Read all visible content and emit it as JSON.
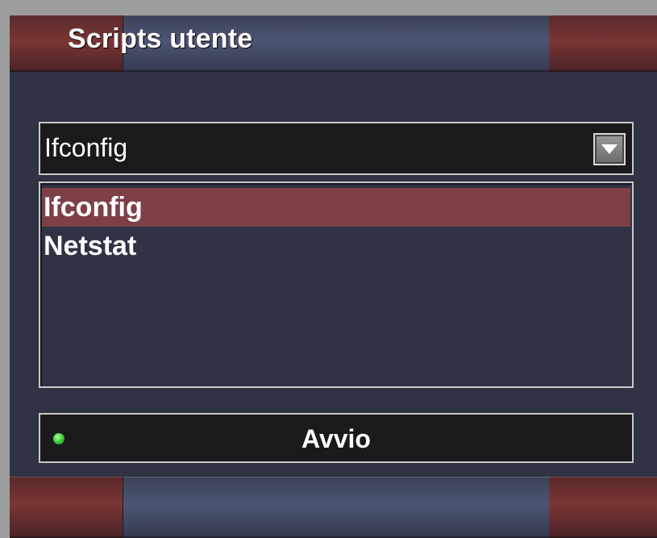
{
  "window": {
    "title": "Scripts utente"
  },
  "dropdown": {
    "selected_value": "Ifconfig",
    "icon": "chevron-down-icon"
  },
  "script_list": {
    "items": [
      {
        "label": "Ifconfig",
        "selected": true
      },
      {
        "label": "Netstat",
        "selected": false
      }
    ]
  },
  "action_button": {
    "label": "Avvio",
    "status_led_color": "#3fd43a"
  },
  "colors": {
    "accent_red": "#7d4047",
    "panel_bg": "#2f3344",
    "field_bg": "#1a1a1d"
  }
}
